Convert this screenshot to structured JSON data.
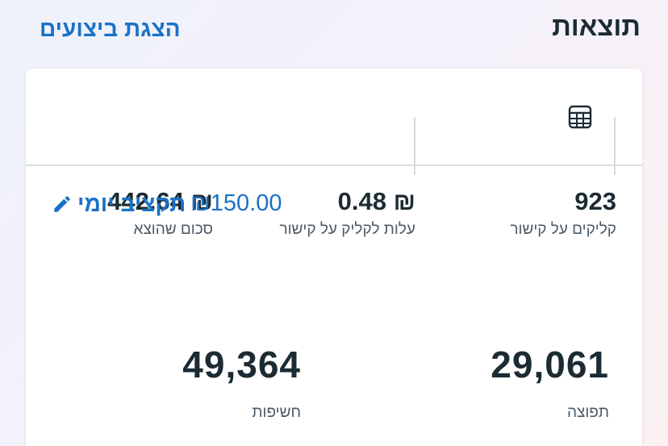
{
  "header": {
    "title": "תוצאות",
    "view_link": "הצגת ביצועים"
  },
  "card": {
    "icons": {
      "table": "table-grid-icon",
      "edit": "pencil-icon"
    },
    "metrics": [
      {
        "value": "923",
        "label": "קליקים על קישור"
      },
      {
        "value": "₪ 0.48",
        "label": "עלות לקליק על קישור"
      },
      {
        "value": "₪ 442.64",
        "label": "סכום שהוצא"
      }
    ],
    "budget": {
      "amount": "₪150.00",
      "label": "תקציב יומי"
    },
    "big_metrics": [
      {
        "value": "29,061",
        "label": "תפוצה"
      },
      {
        "value": "49,364",
        "label": "חשיפות"
      }
    ]
  },
  "colors": {
    "accent": "#1a72c6",
    "text": "#1c2b33",
    "muted": "#4b5a66"
  }
}
